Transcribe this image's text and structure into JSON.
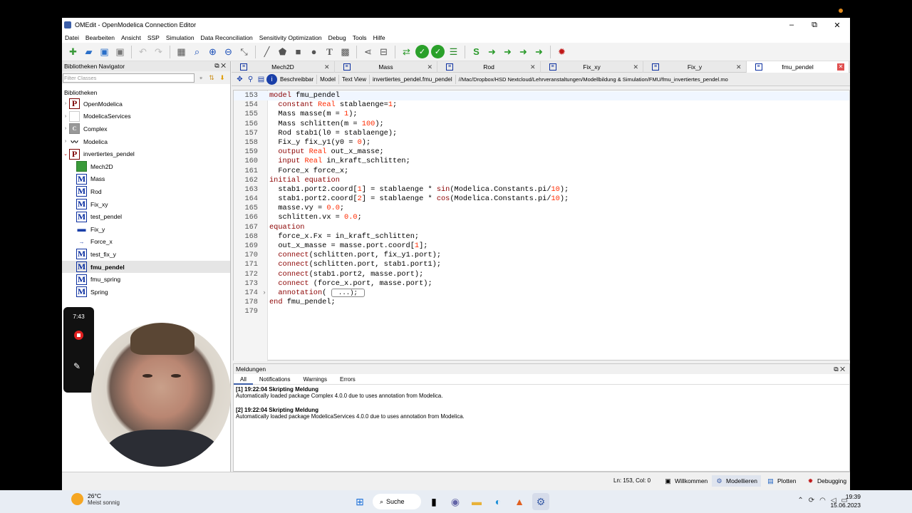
{
  "window": {
    "title": "OMEdit - OpenModelica Connection Editor",
    "min": "–",
    "max": "⧉",
    "close": "✕"
  },
  "menu": [
    "Datei",
    "Bearbeiten",
    "Ansicht",
    "SSP",
    "Simulation",
    "Data Reconciliation",
    "Sensitivity Optimization",
    "Debug",
    "Tools",
    "Hilfe"
  ],
  "library": {
    "header": "Bibliotheken Navigator",
    "filter_placeholder": "Filter Classes",
    "label": "Bibliotheken",
    "roots": [
      {
        "name": "OpenModelica",
        "icon": "P"
      },
      {
        "name": "ModelicaServices",
        "icon": ""
      },
      {
        "name": "Complex",
        "icon": "C"
      },
      {
        "name": "Modelica",
        "icon": "wave"
      },
      {
        "name": "invertiertes_pendel",
        "icon": "P"
      }
    ],
    "children": [
      "Mech2D",
      "Mass",
      "Rod",
      "Fix_xy",
      "test_pendel",
      "Fix_y",
      "Force_x",
      "test_fix_y",
      "fmu_pendel",
      "fmu_spring",
      "Spring"
    ]
  },
  "tabs": [
    {
      "label": "Mech2D"
    },
    {
      "label": "Mass"
    },
    {
      "label": "Rod"
    },
    {
      "label": "Fix_xy"
    },
    {
      "label": "Fix_y"
    },
    {
      "label": "fmu_pendel"
    }
  ],
  "subbar": {
    "buttons": [
      "Beschreibbar",
      "Model",
      "Text View",
      "invertiertes_pendel.fmu_pendel"
    ],
    "path": "//Mac/Dropbox/HSD Nextcloud/Lehrveranstaltungen/Modellbildung & Simulation/FMU/fmu_invertiertes_pendel.mo"
  },
  "code": [
    {
      "n": "153",
      "t": "model fmu_pendel"
    },
    {
      "n": "154",
      "t": "  constant Real stablaenge=1;"
    },
    {
      "n": "155",
      "t": "  Mass masse(m = 1);"
    },
    {
      "n": "156",
      "t": "  Mass schlitten(m = 100);"
    },
    {
      "n": "157",
      "t": "  Rod stab1(l0 = stablaenge);"
    },
    {
      "n": "158",
      "t": "  Fix_y fix_y1(y0 = 0);"
    },
    {
      "n": "159",
      "t": "  output Real out_x_masse;"
    },
    {
      "n": "160",
      "t": "  input Real in_kraft_schlitten;"
    },
    {
      "n": "161",
      "t": "  Force_x force_x;"
    },
    {
      "n": "162",
      "t": "initial equation"
    },
    {
      "n": "163",
      "t": "  stab1.port2.coord[1] = stablaenge * sin(Modelica.Constants.pi/10);"
    },
    {
      "n": "164",
      "t": "  stab1.port2.coord[2] = stablaenge * cos(Modelica.Constants.pi/10);"
    },
    {
      "n": "165",
      "t": "  masse.vy = 0.0;"
    },
    {
      "n": "166",
      "t": "  schlitten.vx = 0.0;"
    },
    {
      "n": "167",
      "t": "equation"
    },
    {
      "n": "168",
      "t": "  force_x.Fx = in_kraft_schlitten;"
    },
    {
      "n": "169",
      "t": "  out_x_masse = masse.port.coord[1];"
    },
    {
      "n": "170",
      "t": "  connect(schlitten.port, fix_y1.port);"
    },
    {
      "n": "171",
      "t": "  connect(schlitten.port, stab1.port1);"
    },
    {
      "n": "172",
      "t": "  connect(stab1.port2, masse.port);"
    },
    {
      "n": "173",
      "t": "  connect (force_x.port, masse.port);"
    },
    {
      "n": "174",
      "t": "  annotation( ",
      "collapsed": " ...); ",
      "fold": "›"
    },
    {
      "n": "178",
      "t": "end fmu_pendel;"
    },
    {
      "n": "179",
      "t": ""
    }
  ],
  "messages": {
    "header": "Meldungen",
    "tabs": [
      "All",
      "Notifications",
      "Warnings",
      "Errors"
    ],
    "items": [
      {
        "head": "[1] 19:22:04 Skripting Meldung",
        "body": "Automatically loaded package Complex 4.0.0 due to uses annotation from Modelica."
      },
      {
        "head": "[2] 19:22:04 Skripting Meldung",
        "body": "Automatically loaded package ModelicaServices 4.0.0 due to uses annotation from Modelica."
      }
    ]
  },
  "status": {
    "position": "Ln: 153, Col: 0",
    "perspectives": [
      "Willkommen",
      "Modellieren",
      "Plotten",
      "Debugging"
    ]
  },
  "recorder": {
    "time": "7:43"
  },
  "taskbar": {
    "weather_temp": "26°C",
    "weather_text": "Meist sonnig",
    "search": "Suche",
    "time": "19:39",
    "date": "15.06.2023"
  }
}
